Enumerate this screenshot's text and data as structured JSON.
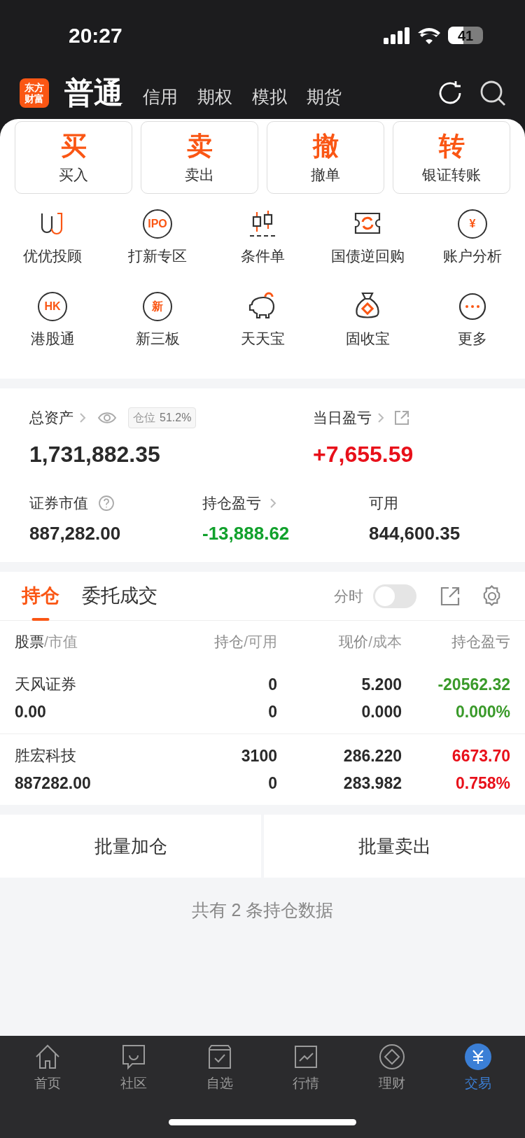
{
  "status_bar": {
    "time": "20:27",
    "battery": "41"
  },
  "header": {
    "logo_lines": [
      "东方",
      "财富"
    ],
    "tabs": [
      {
        "label": "普通",
        "selected": true
      },
      {
        "label": "信用",
        "selected": false
      },
      {
        "label": "期权",
        "selected": false
      },
      {
        "label": "模拟",
        "selected": false
      },
      {
        "label": "期货",
        "selected": false
      }
    ]
  },
  "quick_actions": [
    {
      "glyph": "买",
      "label": "买入"
    },
    {
      "glyph": "卖",
      "label": "卖出"
    },
    {
      "glyph": "撤",
      "label": "撤单"
    },
    {
      "glyph": "转",
      "label": "银证转账"
    }
  ],
  "services": [
    {
      "label": "优优投顾"
    },
    {
      "label": "打新专区",
      "badge": "IPO"
    },
    {
      "label": "条件单"
    },
    {
      "label": "国债逆回购"
    },
    {
      "label": "账户分析",
      "badge": "¥"
    },
    {
      "label": "港股通",
      "badge": "HK"
    },
    {
      "label": "新三板",
      "badge": "新"
    },
    {
      "label": "天天宝"
    },
    {
      "label": "固收宝"
    },
    {
      "label": "更多"
    }
  ],
  "assets": {
    "total": {
      "label": "总资产",
      "badge_label": "仓位",
      "badge_value": "51.2%",
      "value": "1,731,882.35"
    },
    "daily": {
      "label": "当日盈亏",
      "value": "+7,655.59",
      "color": "#e8101a"
    },
    "market_value": {
      "label": "证券市值",
      "value": "887,282.00"
    },
    "holding_pl": {
      "label": "持仓盈亏",
      "value": "-13,888.62",
      "color": "#11a12c"
    },
    "available": {
      "label": "可用",
      "value": "844,600.35"
    }
  },
  "positions": {
    "tabs": [
      {
        "label": "持仓",
        "selected": true
      },
      {
        "label": "委托成交",
        "selected": false
      }
    ],
    "toggle": {
      "label": "分时",
      "on": false
    },
    "columns": [
      {
        "main": "股票",
        "sub": "/市值"
      },
      {
        "main": "持仓",
        "sub": "/可用"
      },
      {
        "main": "现价",
        "sub": "/成本"
      },
      {
        "main": "持仓盈亏"
      }
    ],
    "rows": [
      {
        "name": "天风证券",
        "market_value": "0.00",
        "holding": "0",
        "available": "0",
        "price": "5.200",
        "cost": "0.000",
        "pl": "-20562.32",
        "pl_pct": "0.000%",
        "color": "#3a9a2a"
      },
      {
        "name": "胜宏科技",
        "market_value": "887282.00",
        "holding": "3100",
        "available": "0",
        "price": "286.220",
        "cost": "283.982",
        "pl": "6673.70",
        "pl_pct": "0.758%",
        "color": "#e8101a"
      }
    ],
    "batch_buttons": [
      "批量加仓",
      "批量卖出"
    ],
    "summary": "共有 2 条持仓数据"
  },
  "tab_bar": [
    {
      "label": "首页",
      "selected": false
    },
    {
      "label": "社区",
      "selected": false
    },
    {
      "label": "自选",
      "selected": false
    },
    {
      "label": "行情",
      "selected": false
    },
    {
      "label": "理财",
      "selected": false
    },
    {
      "label": "交易",
      "selected": true
    }
  ]
}
